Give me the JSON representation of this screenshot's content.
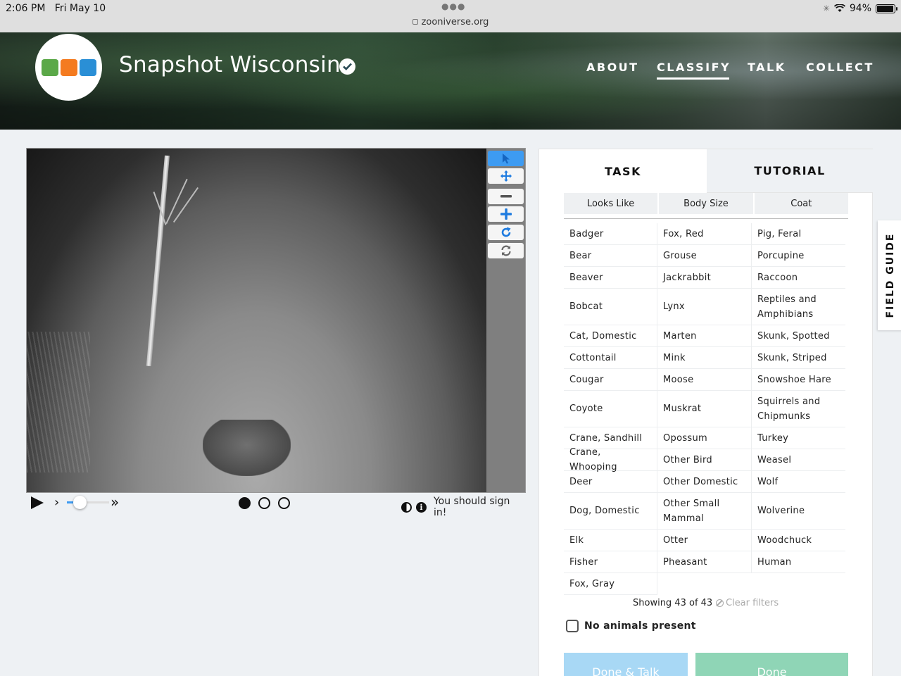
{
  "status": {
    "time": "2:06 PM",
    "date": "Fri May 10",
    "url": "zooniverse.org",
    "battery": "94%",
    "battery_level": 0.94
  },
  "header": {
    "title": "Snapshot Wisconsin",
    "nav": [
      "ABOUT",
      "CLASSIFY",
      "TALK",
      "COLLECT"
    ],
    "active_nav": "CLASSIFY",
    "logo_colors": [
      "#5ba848",
      "#f47b20",
      "#2a8fd6"
    ]
  },
  "viewer": {
    "tools": [
      "pointer-icon",
      "move-icon",
      "zoom-out-icon",
      "zoom-in-icon",
      "rotate-icon",
      "reset-icon"
    ],
    "playback_speed_level": 0.3,
    "frames": 3,
    "active_frame": 1,
    "sign_in_text": "You should sign in!"
  },
  "panel": {
    "tabs": {
      "task": "TASK",
      "tutorial": "TUTORIAL"
    },
    "filters": [
      "Looks Like",
      "Body Size",
      "Coat"
    ],
    "animals": [
      "Badger",
      "Fox, Red",
      "Pig, Feral",
      "Bear",
      "Grouse",
      "Porcupine",
      "Beaver",
      "Jackrabbit",
      "Raccoon",
      "Bobcat",
      "Lynx",
      "Reptiles and Amphibians",
      "Cat, Domestic",
      "Marten",
      "Skunk, Spotted",
      "Cottontail",
      "Mink",
      "Skunk, Striped",
      "Cougar",
      "Moose",
      "Snowshoe Hare",
      "Coyote",
      "Muskrat",
      "Squirrels and Chipmunks",
      "Crane, Sandhill",
      "Opossum",
      "Turkey",
      "Crane, Whooping",
      "Other Bird",
      "Weasel",
      "Deer",
      "Other Domestic",
      "Wolf",
      "Dog, Domestic",
      "Other Small Mammal",
      "Wolverine",
      "Elk",
      "Otter",
      "Woodchuck",
      "Fisher",
      "Pheasant",
      "Human",
      "Fox, Gray"
    ],
    "showing": "Showing 43 of 43",
    "clear_filters": "Clear filters",
    "no_animals": "No animals present",
    "done_talk": "Done & Talk",
    "done": "Done"
  },
  "field_guide": "FIELD GUIDE"
}
